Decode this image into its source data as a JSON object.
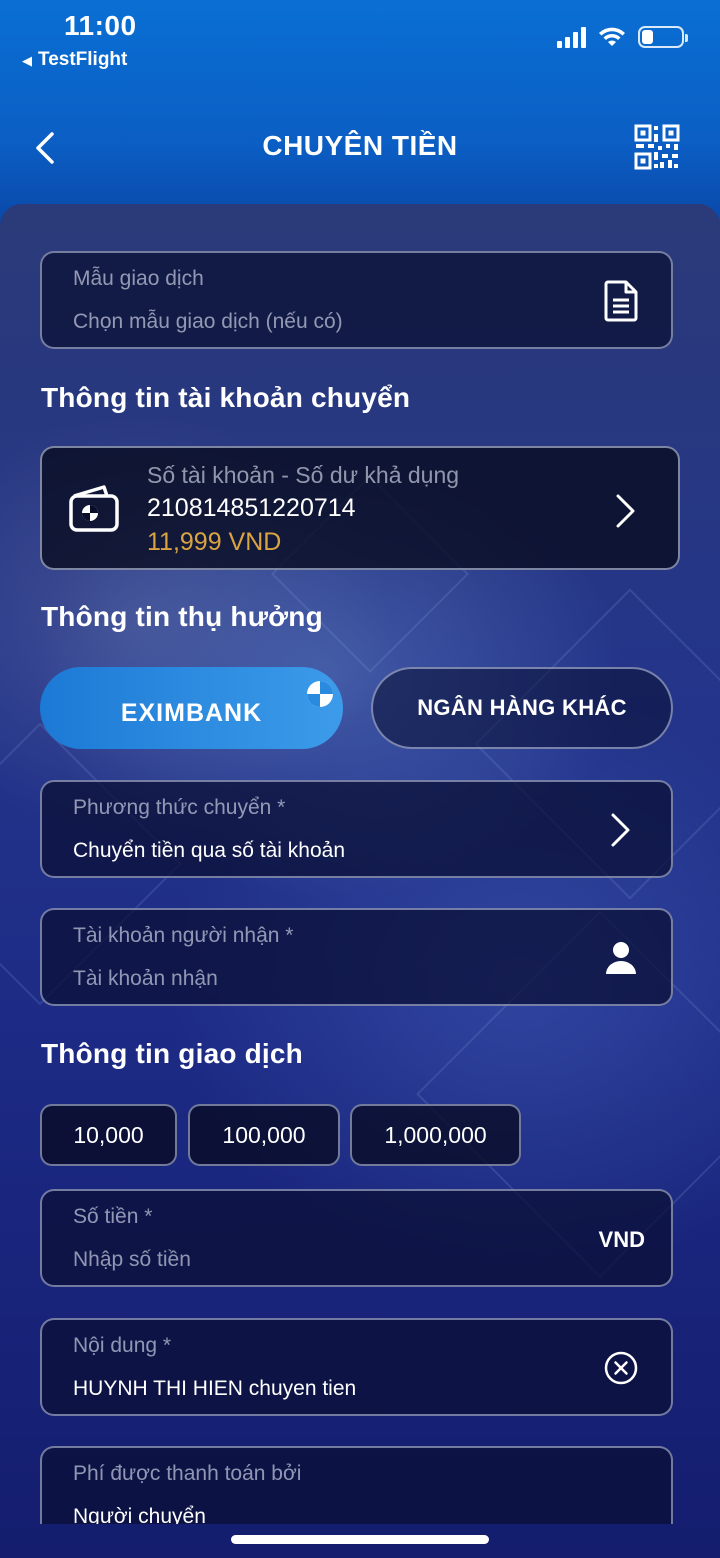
{
  "status_bar": {
    "time": "11:00",
    "back_app": "TestFlight",
    "battery_level": 0.2
  },
  "nav": {
    "title": "CHUYÊN TIỀN",
    "back_icon": "chevron-left-icon",
    "qr_icon": "qr-code-icon"
  },
  "template_field": {
    "label": "Mẫu giao dịch",
    "placeholder": "Chọn mẫu giao dịch (nếu có)",
    "icon": "document-icon"
  },
  "source_section": {
    "title": "Thông tin tài khoản chuyển",
    "card": {
      "label": "Số tài khoản - Số dư khả dụng",
      "account_number": "210814851220714",
      "balance": "11,999 VND",
      "balance_color": "#d9a441"
    }
  },
  "beneficiary_section": {
    "title": "Thông tin thụ hưởng",
    "bank_options": [
      {
        "label": "EXIMBANK",
        "selected": true
      },
      {
        "label": "NGÂN HÀNG KHÁC",
        "selected": false
      }
    ],
    "transfer_method": {
      "label": "Phương thức chuyển *",
      "value": "Chuyển tiền qua số tài khoản"
    },
    "recipient_account": {
      "label": "Tài khoản người nhận *",
      "placeholder": "Tài khoản nhận"
    }
  },
  "transaction_section": {
    "title": "Thông tin giao dịch",
    "quick_amounts": [
      "10,000",
      "100,000",
      "1,000,000"
    ],
    "amount": {
      "label": "Số tiền *",
      "placeholder": "Nhập số tiền",
      "unit": "VND"
    },
    "content": {
      "label": "Nội dung *",
      "value": "HUYNH THI HIEN chuyen tien"
    },
    "fee_payer": {
      "label": "Phí được thanh toán bởi",
      "value": "Người chuyển"
    }
  },
  "colors": {
    "header_blue": "#0a6fd3",
    "selected_bank": "#2a8ae0",
    "background_navy": "#1d2b86"
  }
}
